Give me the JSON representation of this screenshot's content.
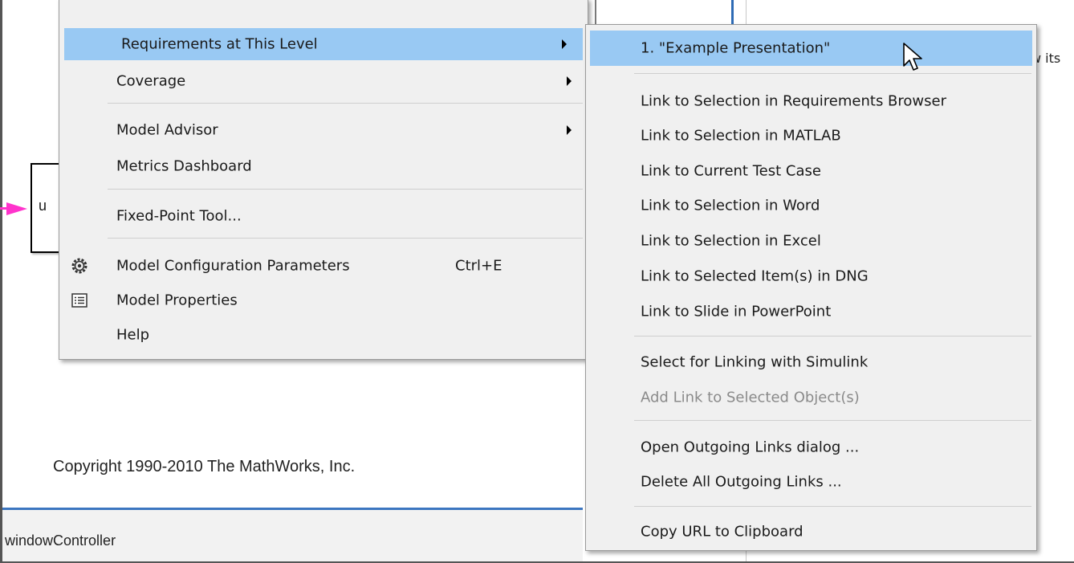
{
  "background": {
    "clipped_text": "w its",
    "block_port_label": "u",
    "copyright": "Copyright 1990-2010 The MathWorks, Inc.",
    "status_bar_text": "windowController"
  },
  "main_menu": {
    "items": [
      {
        "label": "Requirements at This Level",
        "has_submenu": true,
        "highlighted": true
      },
      {
        "label": "Coverage",
        "has_submenu": true
      },
      {
        "label": "Model Advisor",
        "has_submenu": true
      },
      {
        "label": "Metrics Dashboard"
      },
      {
        "label": "Fixed-Point Tool..."
      },
      {
        "label": "Model Configuration Parameters",
        "shortcut": "Ctrl+E",
        "icon": "gear-icon"
      },
      {
        "label": "Model Properties",
        "icon": "properties-list-icon"
      },
      {
        "label": "Help"
      }
    ]
  },
  "sub_menu": {
    "items": [
      {
        "label": "1. \"Example Presentation\"",
        "highlighted": true
      },
      {
        "label": "Link to Selection in Requirements Browser"
      },
      {
        "label": "Link to Selection in MATLAB"
      },
      {
        "label": "Link to Current Test Case"
      },
      {
        "label": "Link to Selection in Word"
      },
      {
        "label": "Link to Selection in Excel"
      },
      {
        "label": "Link to Selected Item(s) in DNG"
      },
      {
        "label": "Link to Slide in PowerPoint"
      },
      {
        "label": "Select for Linking with Simulink"
      },
      {
        "label": "Add Link to Selected Object(s)",
        "disabled": true
      },
      {
        "label": "Open Outgoing Links dialog ..."
      },
      {
        "label": "Delete All Outgoing Links ..."
      },
      {
        "label": "Copy URL to Clipboard"
      }
    ]
  },
  "colors": {
    "highlight": "#99c9f3",
    "menu_background": "#f0f0f0",
    "port_arrow": "#ff33cc",
    "status_line": "#3c76c0"
  }
}
